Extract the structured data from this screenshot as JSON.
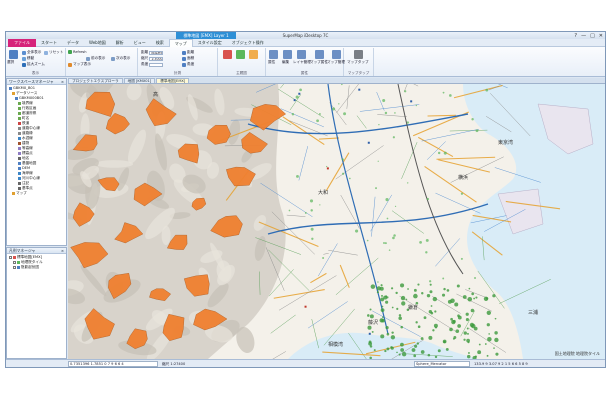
{
  "app": {
    "title": "SuperMap iDesktop 7C",
    "context_tab": "標準地図 [EMX] Layer 1"
  },
  "window_controls": {
    "help": "?",
    "minimize": "—",
    "maximize": "□",
    "close": "✕"
  },
  "ribbon_tabs": [
    "ファイル",
    "スタート",
    "データ",
    "Web地図",
    "解析",
    "ビュー",
    "検索",
    "マップ",
    "スタイル設定",
    "オブジェクト操作"
  ],
  "ribbon": {
    "group_labels": [
      "表示",
      "計測",
      "",
      "主題図",
      "属性",
      "",
      "マップタップ"
    ],
    "browse": {
      "select": "選択",
      "free_label": "全体表示",
      "reset": "リセット",
      "pan": "移動",
      "zoom": "拡大ズーム"
    },
    "refresh_label": "Refresh",
    "prev_view_label": "前の表示",
    "next_view_label": "次の表示",
    "fullmap_label": "マップ表示",
    "map_input_label": "標準地図",
    "measure": {
      "distance": "距離",
      "area": "面積",
      "angle": "角度"
    },
    "scale_label": "縮尺",
    "scale_value": "1:3000",
    "theme": {
      "label": "主題図"
    },
    "attribute_buttons": [
      "属性",
      "編集",
      "レイヤ管理",
      "マップ属性",
      "マップ管理"
    ],
    "map_tap_label": "マップタップ"
  },
  "workspace_panel": {
    "title": "ワークスペースマネージャ",
    "items": [
      "GBKMX_B01",
      "データソース",
      "GBKMX00B01",
      "境界線",
      "行政区画",
      "都道府県",
      "町名",
      "鉄道",
      "道路中心線",
      "道路縁",
      "水涯線",
      "建物",
      "等高線",
      "標高点",
      "地名",
      "基盤地図",
      "DEM",
      "海岸線",
      "河川中心線",
      "注記",
      "基準点",
      "マップ"
    ]
  },
  "layer_panel": {
    "title": "凡例マネージャ",
    "items": [
      "標準地図[EMX]",
      "地理院タイル",
      "陰影起伏図"
    ]
  },
  "map_tabs": [
    "プロジェクトエクスプローラ",
    "地図 [KMX01]",
    "標準地図[EMX]"
  ],
  "status": {
    "coords": "0.7351396 1.7851 0 7 9 6 6 4",
    "scale": "縮尺 1:27400",
    "projection": "Sphere_Mercator",
    "extra": "133.9 9 3.07 9 2 1 5 6 6 5 8 9"
  },
  "map_labels": [
    "高",
    "東京湾",
    "横浜",
    "大和",
    "鎌倉",
    "相模湾",
    "藤沢",
    "三浦"
  ],
  "map_attribution": "国土地理院 地理院タイル",
  "colors": {
    "titlebar_accent": "#2e8fd6",
    "file_tab": "#d6237a",
    "landslide_fill": "#f08030",
    "map_background": "#f4f1ea"
  }
}
